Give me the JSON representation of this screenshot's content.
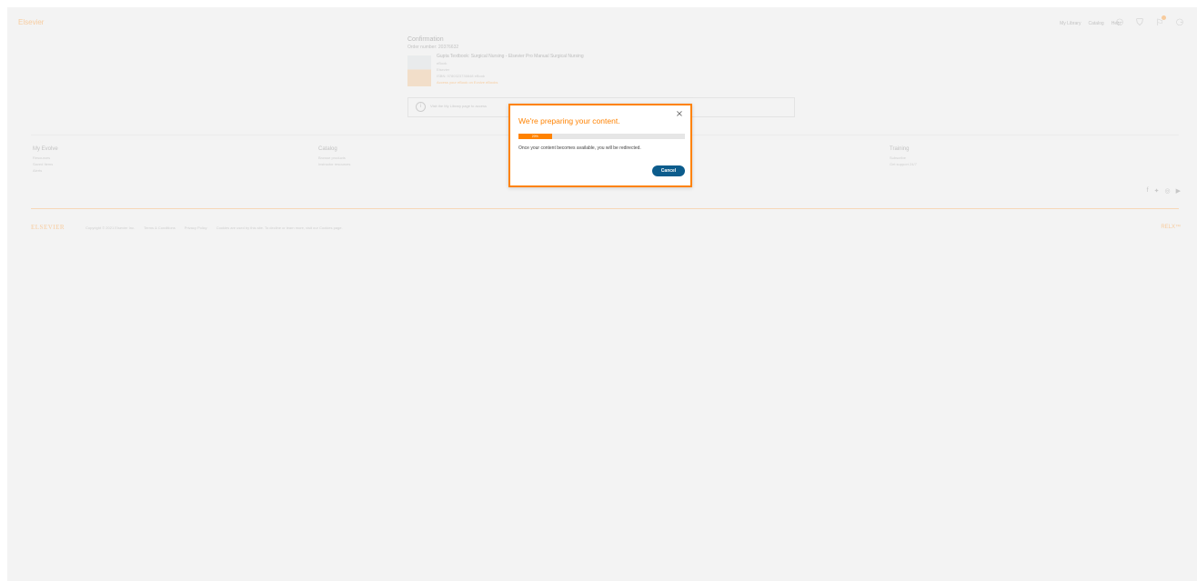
{
  "header": {
    "logo": "Elsevier",
    "nav": [
      "My Library",
      "Catalog",
      "Help"
    ],
    "icons": [
      "user-icon",
      "cart-icon",
      "notification-icon",
      "account-icon"
    ]
  },
  "confirmation": {
    "title": "Confirmation",
    "order_number": "Order number: 20376632",
    "book_title": "Gupta Textbook: Surgical Nursing - Elsevier Pro Manual Surgical Nursing",
    "lines": [
      "eBook",
      "Elsevier",
      "ISBN: 9780323736848 eBook",
      "Access your eBook on Evolve eBooks"
    ],
    "notice": "Visit the My Library page to access"
  },
  "footer": {
    "columns": [
      {
        "head": "My Evolve",
        "items": [
          "Resources",
          "Saved Items",
          "Alerts"
        ]
      },
      {
        "head": "Catalog",
        "items": [
          "Browse products",
          "Instructor resources"
        ]
      },
      {
        "head": "Training",
        "items": [
          "Subscribe",
          "Get support 24/7"
        ]
      }
    ],
    "social_icons": [
      "facebook-icon",
      "twitter-icon",
      "instagram-icon",
      "youtube-icon"
    ],
    "brand": "ELSEVIER",
    "legal": [
      "Copyright © 2021 Elsevier Inc.",
      "Terms & Conditions",
      "Privacy Policy",
      "Cookies are used by this site. To decline or learn more, visit our Cookies page."
    ],
    "relx": "RELX™"
  },
  "modal": {
    "title": "We're preparing your content.",
    "progress_label": "20%",
    "progress": 0.2,
    "message": "Once your content becomes available, you will be redirected.",
    "cancel_label": "Cancel",
    "close_glyph": "×"
  },
  "colors": {
    "accent": "#ff8200",
    "button": "#0c5c8c"
  }
}
